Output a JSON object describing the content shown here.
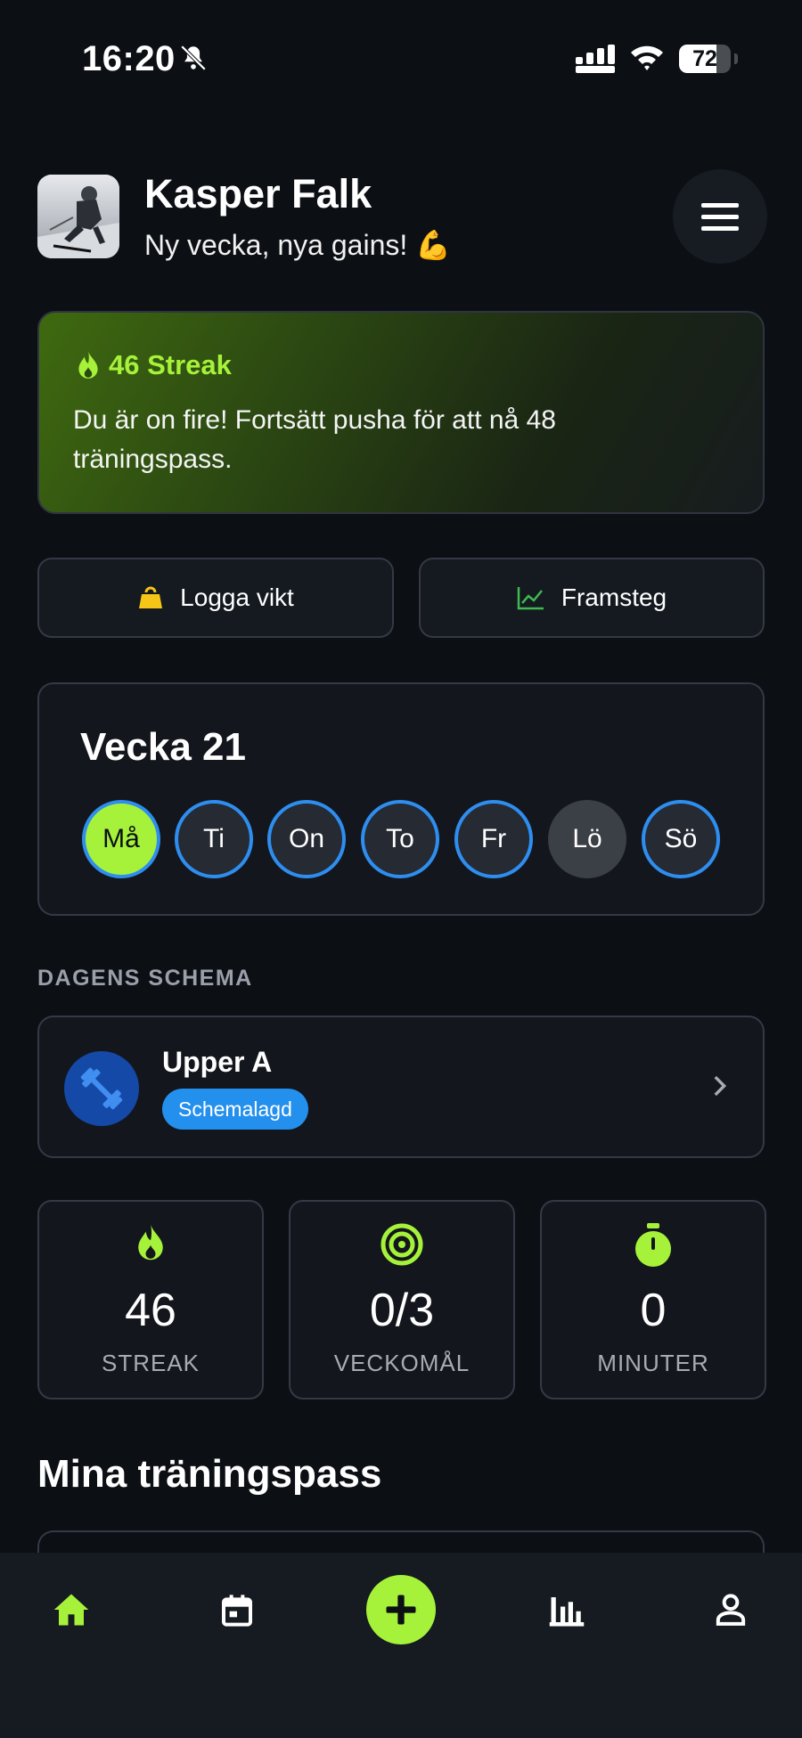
{
  "status_bar": {
    "time": "16:20",
    "battery": "72",
    "battery_level": 0.72
  },
  "header": {
    "name": "Kasper Falk",
    "subtitle": "Ny vecka, nya gains! 💪"
  },
  "streak": {
    "title": "46 Streak",
    "message": "Du är on fire! Fortsätt pusha för att nå 48 träningspass."
  },
  "actions": {
    "log_weight": "Logga vikt",
    "progress": "Framsteg"
  },
  "week": {
    "title": "Vecka 21",
    "days": [
      "Må",
      "Ti",
      "On",
      "To",
      "Fr",
      "Lö",
      "Sö"
    ]
  },
  "today": {
    "section_label": "DAGENS SCHEMA",
    "workout_name": "Upper A",
    "badge": "Schemalagd"
  },
  "stats": {
    "streak_value": "46",
    "streak_label": "STREAK",
    "goal_value": "0/3",
    "goal_label": "VECKOMÅL",
    "minutes_value": "0",
    "minutes_label": "MINUTER"
  },
  "my_workouts": {
    "title": "Mina träningspass"
  },
  "colors": {
    "accent": "#a6f23a",
    "blue": "#2e8ef0",
    "background": "#0c0f14"
  },
  "nav": {
    "icons": [
      "home-icon",
      "calendar-icon",
      "add-icon",
      "chart-icon",
      "profile-icon"
    ]
  }
}
